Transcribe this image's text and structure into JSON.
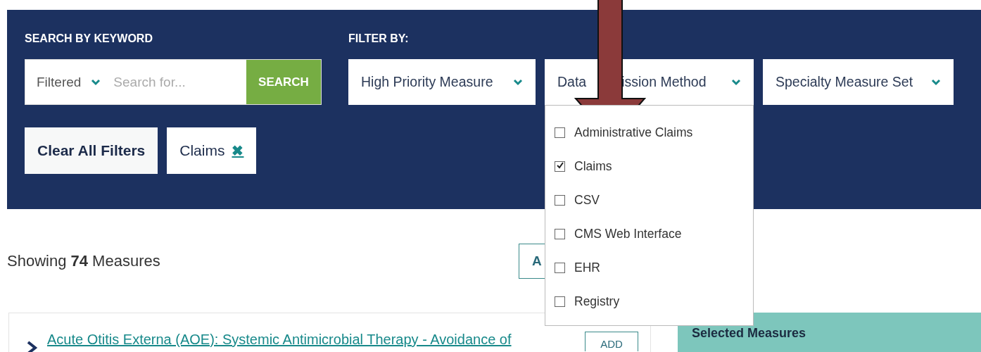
{
  "search": {
    "label": "SEARCH BY KEYWORD",
    "scope": "Filtered",
    "placeholder": "Search for...",
    "button": "SEARCH"
  },
  "filters": {
    "label": "FILTER BY:",
    "dropdowns": [
      {
        "label": "High Priority Measure",
        "expanded": false
      },
      {
        "label": "Data",
        "label_end": "ission Method",
        "expanded": true,
        "options": [
          {
            "label": "Administrative Claims",
            "checked": false
          },
          {
            "label": "Claims",
            "checked": true
          },
          {
            "label": "CSV",
            "checked": false
          },
          {
            "label": "CMS Web Interface",
            "checked": false
          },
          {
            "label": "EHR",
            "checked": false
          },
          {
            "label": "Registry",
            "checked": false
          }
        ]
      },
      {
        "label": "Specialty Measure Set",
        "expanded": false
      }
    ]
  },
  "clear_button": "Clear All Filters",
  "active_filters": [
    {
      "label": "Claims",
      "remove": "✖"
    }
  ],
  "results": {
    "summary": "Showing **74** Measures",
    "add_all_button": "A",
    "measures": [
      {
        "title": "Acute Otitis Externa (AOE): Systemic Antimicrobial Therapy - Avoidance of",
        "button": "ADD"
      }
    ],
    "selected_panel": {
      "title": "Selected Measures"
    }
  }
}
